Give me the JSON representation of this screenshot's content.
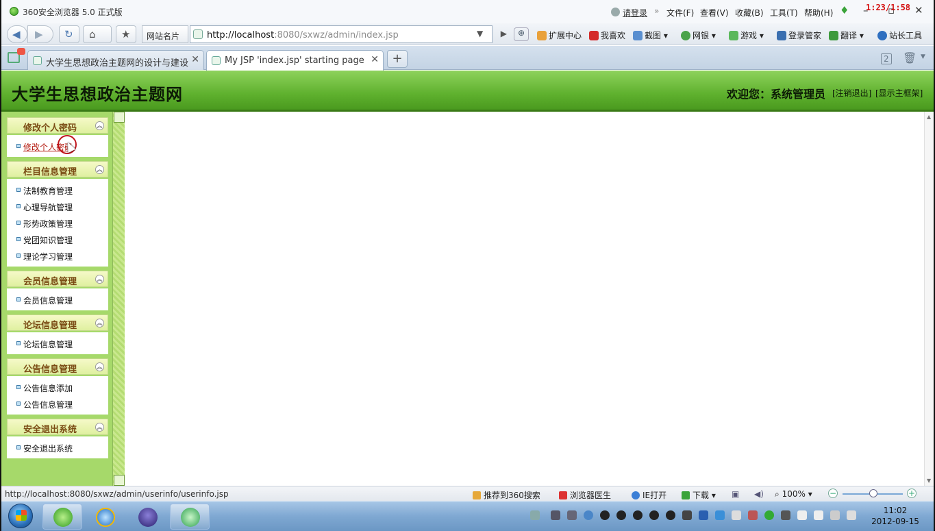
{
  "browser": {
    "title": "360安全浏览器 5.0 正式版",
    "login_label": "请登录",
    "menus": [
      "文件(F)",
      "查看(V)",
      "收藏(B)",
      "工具(T)",
      "帮助(H)"
    ],
    "recording_time": "1:23/1:58",
    "sites_label": "网站名片",
    "url_host": "http://localhost",
    "url_rest": ":8080/sxwz/admin/index.jsp",
    "toolbar_items": [
      "扩展中心",
      "我喜欢",
      "截图",
      "网银",
      "游戏",
      "登录管家",
      "翻译",
      "站长工具"
    ],
    "tabs": [
      {
        "label": "大学生思想政治主题网的设计与建设",
        "active": false
      },
      {
        "label": "My JSP 'index.jsp' starting page",
        "active": true
      }
    ],
    "tab_count_badge": "2"
  },
  "page": {
    "site_title": "大学生思想政治主题网",
    "welcome": "欢迎您：系统管理员",
    "logout_link": "[注销退出]",
    "frame_link": "[显示主框架]"
  },
  "sidebar": {
    "panels": [
      {
        "title": "修改个人密码",
        "items": [
          "修改个人密码"
        ]
      },
      {
        "title": "栏目信息管理",
        "items": [
          "法制教育管理",
          "心理导航管理",
          "形势政策管理",
          "党团知识管理",
          "理论学习管理"
        ]
      },
      {
        "title": "会员信息管理",
        "items": [
          "会员信息管理"
        ]
      },
      {
        "title": "论坛信息管理",
        "items": [
          "论坛信息管理"
        ]
      },
      {
        "title": "公告信息管理",
        "items": [
          "公告信息添加",
          "公告信息管理"
        ]
      },
      {
        "title": "安全退出系统",
        "items": [
          "安全退出系统"
        ]
      }
    ]
  },
  "statusbar": {
    "url": "http://localhost:8080/sxwz/admin/userinfo/userinfo.jsp",
    "items": [
      "推荐到360搜索",
      "浏览器医生",
      "IE打开",
      "下载"
    ],
    "zoom": "100%"
  },
  "taskbar": {
    "time": "11:02",
    "date": "2012-09-15"
  },
  "colors": {
    "header_green": "#5fb12e",
    "sidebar_green": "#a6d96a",
    "panel_title": "#7a4b14",
    "active_link": "#b3160b"
  }
}
